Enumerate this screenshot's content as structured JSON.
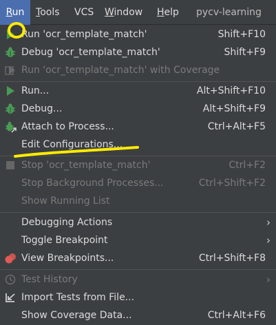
{
  "menubar": {
    "items": [
      {
        "label": "Run",
        "mnemonic": "R",
        "rest": "un"
      },
      {
        "label": "Tools",
        "mnemonic": "T",
        "rest": "ools"
      },
      {
        "label": "VCS",
        "mnemonic": "",
        "rest": "VCS"
      },
      {
        "label": "Window",
        "mnemonic": "W",
        "rest": "indow"
      },
      {
        "label": "Help",
        "mnemonic": "H",
        "rest": "elp"
      }
    ],
    "project_name": "pycv-learning"
  },
  "menu": {
    "items": [
      {
        "label": "Run 'ocr_template_match'",
        "shortcut": "Shift+F10",
        "icon": "run-icon",
        "enabled": true
      },
      {
        "label": "Debug 'ocr_template_match'",
        "shortcut": "Shift+F9",
        "icon": "debug-icon",
        "enabled": true
      },
      {
        "label": "Run 'ocr_template_match' with Coverage",
        "shortcut": "",
        "icon": "coverage-icon",
        "enabled": false
      },
      {
        "label": "Run...",
        "shortcut": "Alt+Shift+F10",
        "icon": "run-icon",
        "enabled": true
      },
      {
        "label": "Debug...",
        "shortcut": "Alt+Shift+F9",
        "icon": "debug-icon",
        "enabled": true
      },
      {
        "label": "Attach to Process...",
        "shortcut": "Ctrl+Alt+F5",
        "icon": "attach-icon",
        "enabled": true
      },
      {
        "label": "Edit Configurations...",
        "shortcut": "",
        "icon": "",
        "enabled": true
      },
      {
        "label": "Stop 'ocr_template_match'",
        "shortcut": "Ctrl+F2",
        "icon": "stop-icon",
        "enabled": false
      },
      {
        "label": "Stop Background Processes...",
        "shortcut": "Ctrl+Shift+F2",
        "icon": "",
        "enabled": false
      },
      {
        "label": "Show Running List",
        "shortcut": "",
        "icon": "",
        "enabled": false
      },
      {
        "label": "Debugging Actions",
        "shortcut": "",
        "icon": "",
        "enabled": true,
        "submenu": true
      },
      {
        "label": "Toggle Breakpoint",
        "shortcut": "",
        "icon": "",
        "enabled": true,
        "submenu": true
      },
      {
        "label": "View Breakpoints...",
        "shortcut": "Ctrl+Shift+F8",
        "icon": "breakpoints-icon",
        "enabled": true
      },
      {
        "label": "Test History",
        "shortcut": "",
        "icon": "history-icon",
        "enabled": false,
        "submenu": true
      },
      {
        "label": "Import Tests from File...",
        "shortcut": "",
        "icon": "import-icon",
        "enabled": true
      },
      {
        "label": "Show Coverage Data...",
        "shortcut": "Ctrl+Alt+F6",
        "icon": "",
        "enabled": true
      }
    ],
    "submenu_glyph": "›"
  },
  "colors": {
    "menu_bg": "#3c3f41",
    "active_menu_bg": "#4b6eaf",
    "run_green": "#499c54",
    "annotation_yellow": "#ffeb00"
  }
}
